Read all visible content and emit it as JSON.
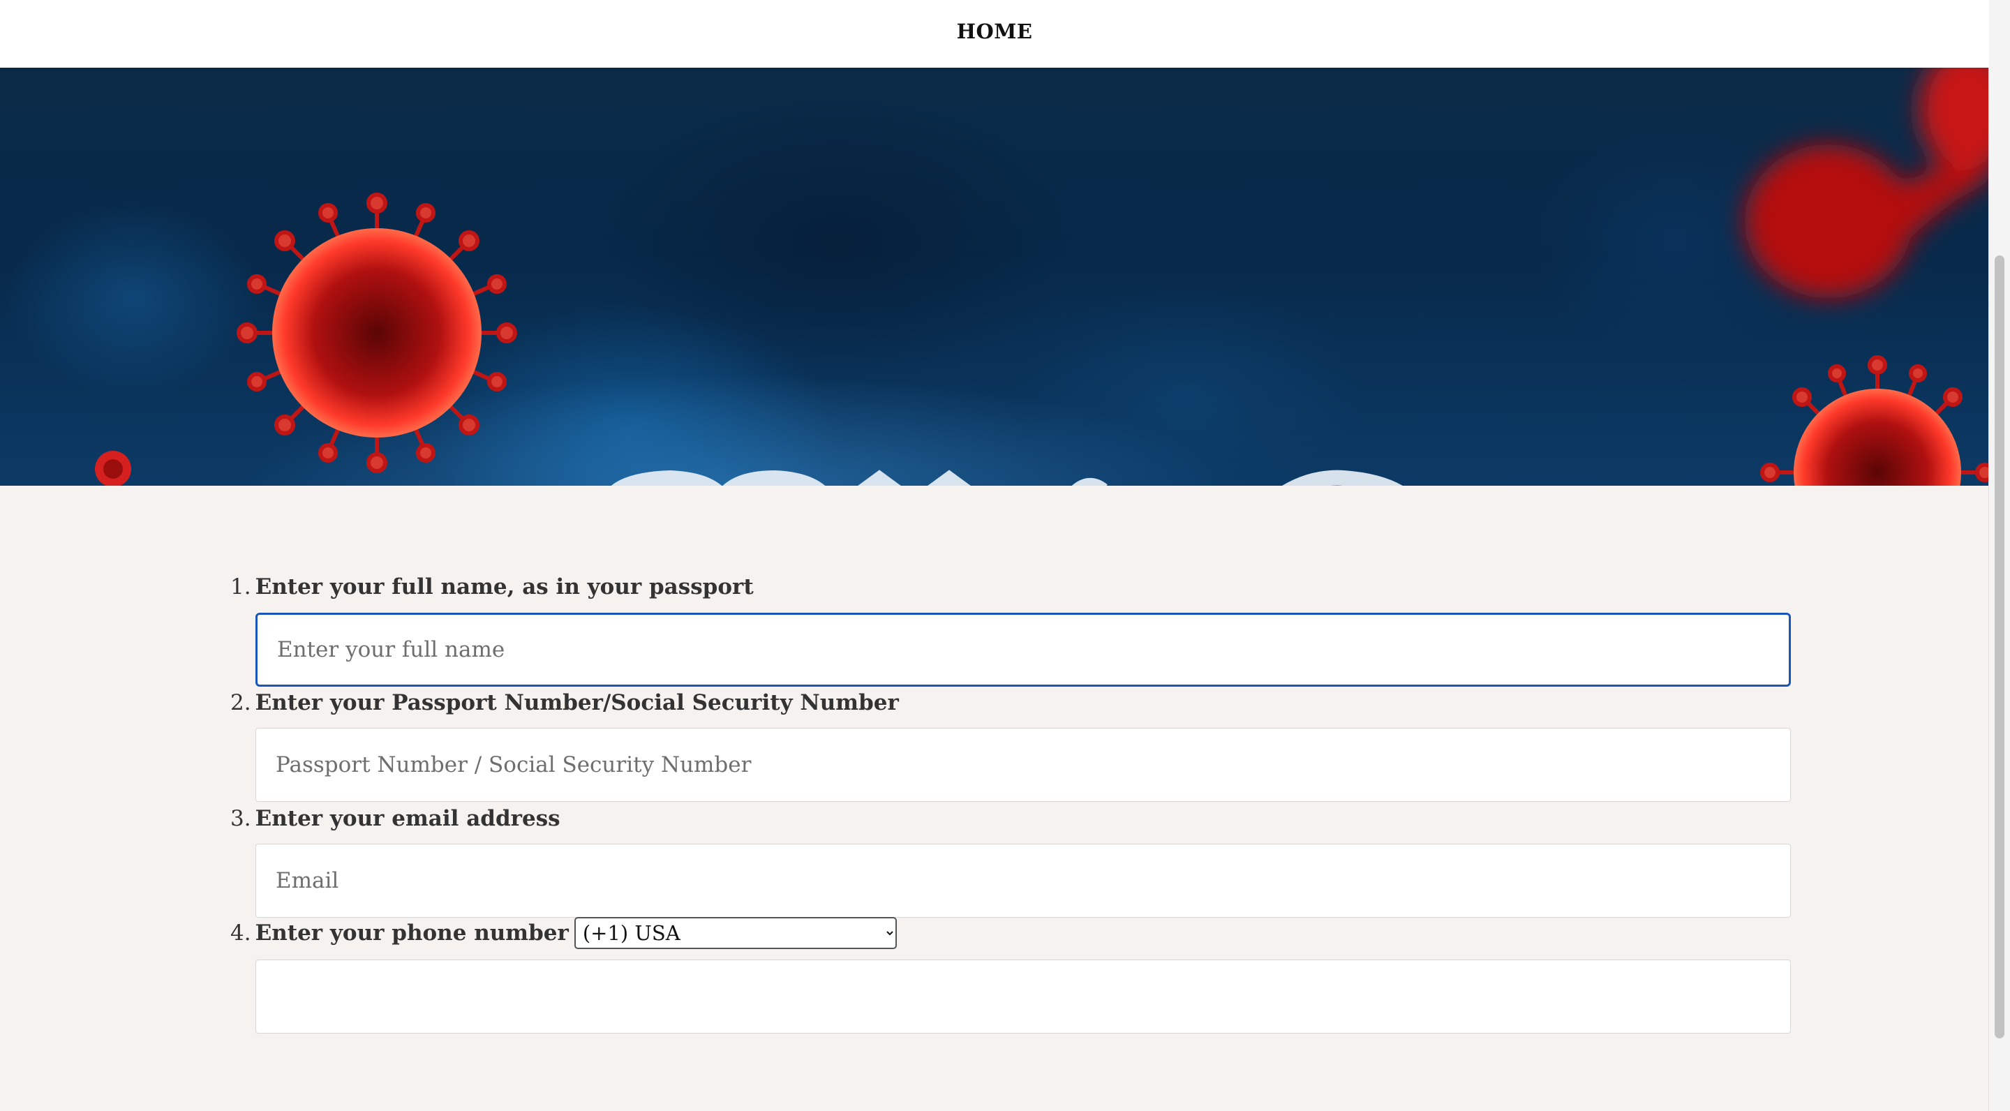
{
  "nav": {
    "home_label": "HOME"
  },
  "hero": {
    "image_description_icon": "covid-virus-banner"
  },
  "form": {
    "questions": [
      {
        "number": "1.",
        "label": "Enter your full name, as in your passport",
        "placeholder": "Enter your full name",
        "value": ""
      },
      {
        "number": "2.",
        "label": "Enter your Passport Number/Social Security Number",
        "placeholder": "Passport Number / Social Security Number",
        "value": ""
      },
      {
        "number": "3.",
        "label": "Enter your email address",
        "placeholder": "Email",
        "value": ""
      },
      {
        "number": "4.",
        "label": "Enter your phone number",
        "placeholder": "",
        "value": "",
        "country_selected": "(+1) USA"
      }
    ]
  },
  "colors": {
    "page_bg": "#f5f2ef",
    "focus_border": "#1a56b8",
    "hero_bg": "#07294a",
    "virus_red": "#d21a1a"
  }
}
